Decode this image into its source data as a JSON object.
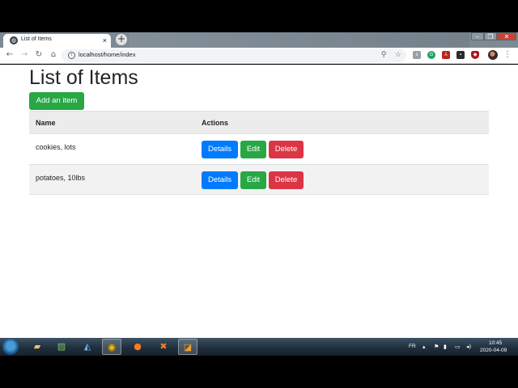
{
  "browser": {
    "tab_title": "List of Items",
    "tab_close": "×",
    "new_tab": "+",
    "url": "localhost/home/index",
    "window_controls": {
      "minimize": "–",
      "maximize": "❐",
      "close": "✕"
    }
  },
  "page": {
    "title": "List of Items",
    "add_button": "Add an item",
    "table": {
      "headers": [
        "Name",
        "Actions"
      ],
      "rows": [
        {
          "name": "cookies, lots"
        },
        {
          "name": "potatoes, 10lbs"
        }
      ],
      "action_labels": {
        "details": "Details",
        "edit": "Edit",
        "delete": "Delete"
      }
    }
  },
  "colors": {
    "success": "#28a745",
    "primary": "#007bff",
    "danger": "#dc3545",
    "table_header_bg": "#ececec"
  },
  "taskbar": {
    "language": "FR",
    "time": "10:45",
    "date": "2020-04-09"
  }
}
